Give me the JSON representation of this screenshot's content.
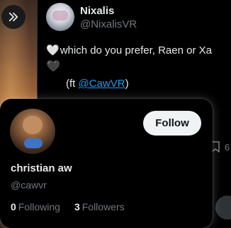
{
  "tweet": {
    "display_name": "Nixalis",
    "handle": "@NixalisVR",
    "text_heart": "🤍",
    "text_main": "which do you prefer, Raen or Xa",
    "second_heart": "🖤",
    "credit_prefix": "(ft ",
    "credit_mention": "@CawVR",
    "credit_suffix": ")",
    "bookmark_count": "6"
  },
  "hover_card": {
    "name": "christian aw",
    "handle": "@cawvr",
    "follow_label": "Follow",
    "following_count": "0",
    "following_label": "Following",
    "followers_count": "3",
    "followers_label": "Followers"
  },
  "icons": {
    "expand": "double-chevron-right-icon",
    "bookmark": "bookmark-icon"
  }
}
